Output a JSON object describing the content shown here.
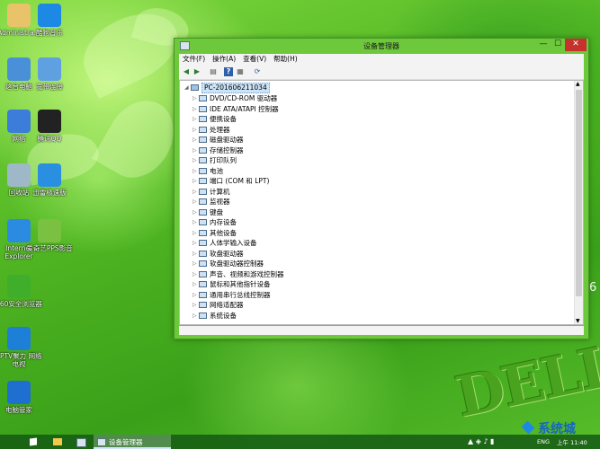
{
  "desktop": {
    "icons": [
      {
        "label": "Administra...",
        "icon": "user-folder-icon",
        "color": "#e8c36a"
      },
      {
        "label": "酷狗音乐",
        "icon": "kugou-music-icon",
        "color": "#1e88e5"
      },
      {
        "label": "这台电脑",
        "icon": "computer-icon",
        "color": "#4a90d9"
      },
      {
        "label": "宽带连接",
        "icon": "network-icon",
        "color": "#5fa0e0"
      },
      {
        "label": "网络",
        "icon": "globe-network-icon",
        "color": "#3b7dd8"
      },
      {
        "label": "腾讯QQ",
        "icon": "qq-penguin-icon",
        "color": "#222222"
      },
      {
        "label": "回收站",
        "icon": "recycle-bin-icon",
        "color": "#9fb8c8"
      },
      {
        "label": "迅雷极速版",
        "icon": "thunder-icon",
        "color": "#2a8fe0"
      },
      {
        "label": "Internet Explorer",
        "icon": "ie-icon",
        "color": "#2b8be0"
      },
      {
        "label": "爱奇艺PPS影音",
        "icon": "iqiyi-icon",
        "color": "#7ac142"
      },
      {
        "label": "360安全浏览器",
        "icon": "360-browser-icon",
        "color": "#3fae2a"
      },
      {
        "label": "PPTV聚力 网络电视",
        "icon": "pptv-icon",
        "color": "#1d7fd6"
      },
      {
        "label": "电脑管家",
        "icon": "guard-shield-icon",
        "color": "#1f6fd0"
      }
    ],
    "logo_text": "DELL",
    "side_number": "6"
  },
  "window": {
    "title": "设备管理器",
    "controls": {
      "minimize": "—",
      "maximize": "☐",
      "close": "✕"
    },
    "menu": [
      "文件(F)",
      "操作(A)",
      "查看(V)",
      "帮助(H)"
    ],
    "toolbar": [
      {
        "icon": "back-arrow-icon",
        "glyph": "◀"
      },
      {
        "icon": "forward-arrow-icon",
        "glyph": "▶"
      },
      {
        "icon": "properties-icon",
        "glyph": "▤"
      },
      {
        "icon": "help-icon",
        "glyph": "?"
      },
      {
        "icon": "view-icon",
        "glyph": "▦"
      },
      {
        "icon": "scan-hardware-icon",
        "glyph": "⟳"
      }
    ],
    "root": "PC-201606211034",
    "devices": [
      "DVD/CD-ROM 驱动器",
      "IDE ATA/ATAPI 控制器",
      "便携设备",
      "处理器",
      "磁盘驱动器",
      "存储控制器",
      "打印队列",
      "电池",
      "端口 (COM 和 LPT)",
      "计算机",
      "监视器",
      "键盘",
      "内存设备",
      "其他设备",
      "人体学输入设备",
      "软盘驱动器",
      "软盘驱动器控制器",
      "声音、视频和游戏控制器",
      "鼠标和其他指针设备",
      "通用串行总线控制器",
      "网络适配器",
      "系统设备"
    ]
  },
  "taskbar": {
    "active_app": "设备管理器",
    "tray_lang": "ENG",
    "clock": "上午 11:40",
    "watermark": "系统城"
  },
  "colors": {
    "window_frame": "#6ec83c",
    "close_button": "#c7312c",
    "selection": "#cce4f7"
  }
}
